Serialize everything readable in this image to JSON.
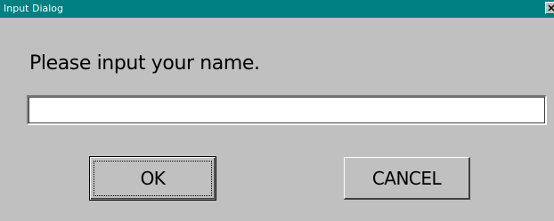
{
  "window": {
    "title": "Input Dialog"
  },
  "dialog": {
    "prompt": "Please input your name.",
    "input_value": "",
    "ok_label": "OK",
    "cancel_label": "CANCEL"
  },
  "icons": {
    "close": "close-icon"
  },
  "colors": {
    "titlebar": "#008080",
    "face": "#c0c0c0",
    "field": "#ffffff"
  }
}
